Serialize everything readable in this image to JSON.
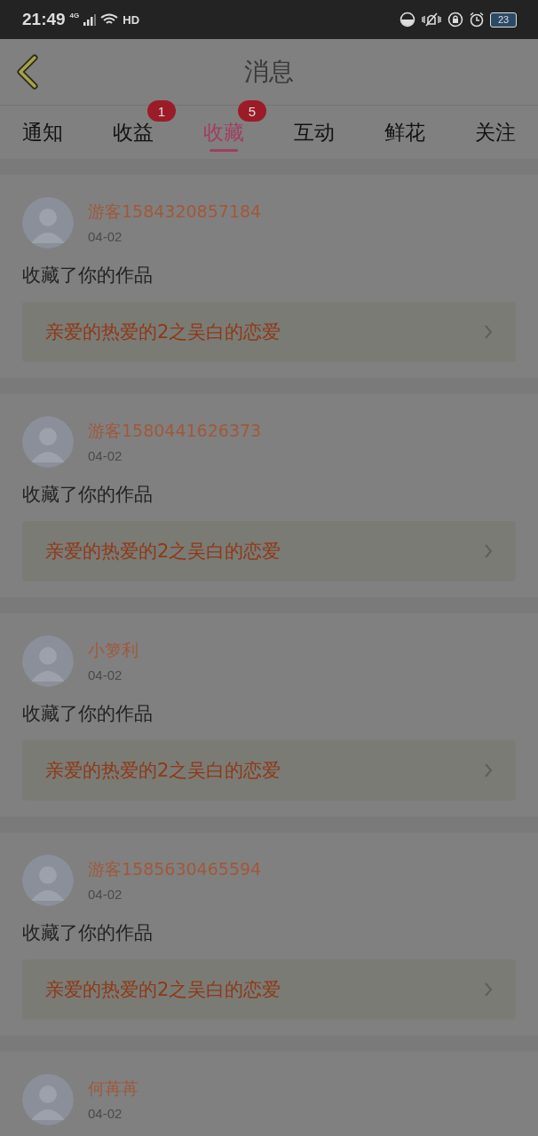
{
  "status_bar": {
    "time": "21:49",
    "network": "4G",
    "call": "HD",
    "battery": "23"
  },
  "header": {
    "title": "消息"
  },
  "tabs": [
    {
      "label": "通知",
      "selected": false
    },
    {
      "label": "收益",
      "selected": false,
      "badge": "1"
    },
    {
      "label": "收藏",
      "selected": true,
      "badge": "5"
    },
    {
      "label": "互动",
      "selected": false
    },
    {
      "label": "鲜花",
      "selected": false
    },
    {
      "label": "关注",
      "selected": false
    }
  ],
  "messages": [
    {
      "user": "游客1584320857184",
      "date": "04-02",
      "action": "收藏了你的作品",
      "work": "亲爱的热爱的2之吴白的恋爱"
    },
    {
      "user": "游客1580441626373",
      "date": "04-02",
      "action": "收藏了你的作品",
      "work": "亲爱的热爱的2之吴白的恋爱"
    },
    {
      "user": "小箩利",
      "date": "04-02",
      "action": "收藏了你的作品",
      "work": "亲爱的热爱的2之吴白的恋爱"
    },
    {
      "user": "游客1585630465594",
      "date": "04-02",
      "action": "收藏了你的作品",
      "work": "亲爱的热爱的2之吴白的恋爱"
    },
    {
      "user": "何苒苒",
      "date": "04-02"
    }
  ]
}
